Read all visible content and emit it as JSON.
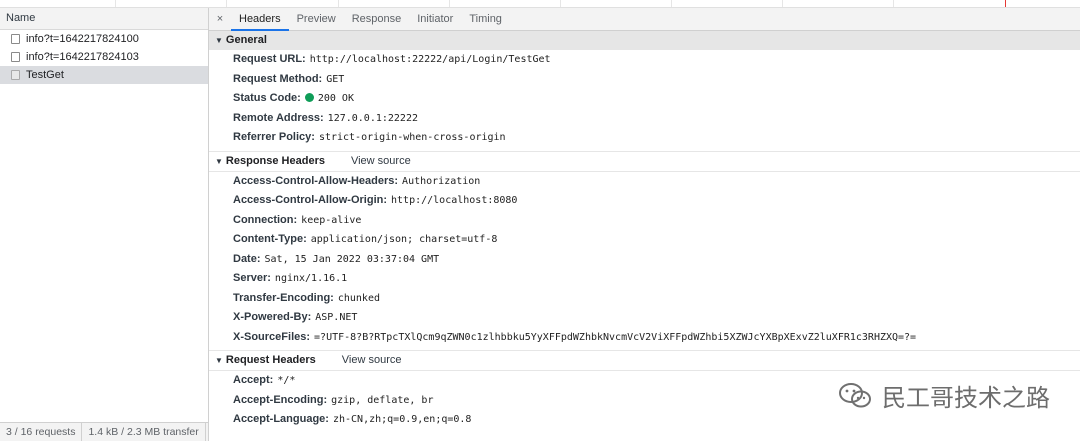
{
  "list": {
    "column_header": "Name",
    "requests": [
      {
        "name": "info?t=1642217824100"
      },
      {
        "name": "info?t=1642217824103"
      },
      {
        "name": "TestGet"
      }
    ],
    "status": {
      "requests": "3 / 16 requests",
      "transferred": "1.4 kB / 2.3 MB transfer"
    }
  },
  "tabs": {
    "close": "×",
    "items": [
      "Headers",
      "Preview",
      "Response",
      "Initiator",
      "Timing"
    ]
  },
  "general": {
    "title": "General",
    "rows": [
      {
        "k": "Request URL:",
        "v": "http://localhost:22222/api/Login/TestGet"
      },
      {
        "k": "Request Method:",
        "v": "GET"
      },
      {
        "k": "Status Code:",
        "v": "200 OK"
      },
      {
        "k": "Remote Address:",
        "v": "127.0.0.1:22222"
      },
      {
        "k": "Referrer Policy:",
        "v": "strict-origin-when-cross-origin"
      }
    ]
  },
  "response_headers": {
    "title": "Response Headers",
    "view_source": "View source",
    "rows": [
      {
        "k": "Access-Control-Allow-Headers:",
        "v": "Authorization"
      },
      {
        "k": "Access-Control-Allow-Origin:",
        "v": "http://localhost:8080"
      },
      {
        "k": "Connection:",
        "v": "keep-alive"
      },
      {
        "k": "Content-Type:",
        "v": "application/json; charset=utf-8"
      },
      {
        "k": "Date:",
        "v": "Sat, 15 Jan 2022 03:37:04 GMT"
      },
      {
        "k": "Server:",
        "v": "nginx/1.16.1"
      },
      {
        "k": "Transfer-Encoding:",
        "v": "chunked"
      },
      {
        "k": "X-Powered-By:",
        "v": "ASP.NET"
      },
      {
        "k": "X-SourceFiles:",
        "v": "=?UTF-8?B?RTpcTXlQcm9qZWN0c1zlhbbku5YyXFFpdWZhbkNvcmVcV2ViXFFpdWZhbi5XZWJcYXBpXExvZ2luXFR1c3RHZXQ=?="
      }
    ]
  },
  "request_headers": {
    "title": "Request Headers",
    "view_source": "View source",
    "rows": [
      {
        "k": "Accept:",
        "v": "*/*"
      },
      {
        "k": "Accept-Encoding:",
        "v": "gzip, deflate, br"
      },
      {
        "k": "Accept-Language:",
        "v": "zh-CN,zh;q=0.9,en;q=0.8"
      }
    ]
  },
  "watermark": {
    "text": "民工哥技术之路"
  },
  "colors": {
    "accent": "#1a73e8",
    "status_ok": "#0f9d58"
  }
}
